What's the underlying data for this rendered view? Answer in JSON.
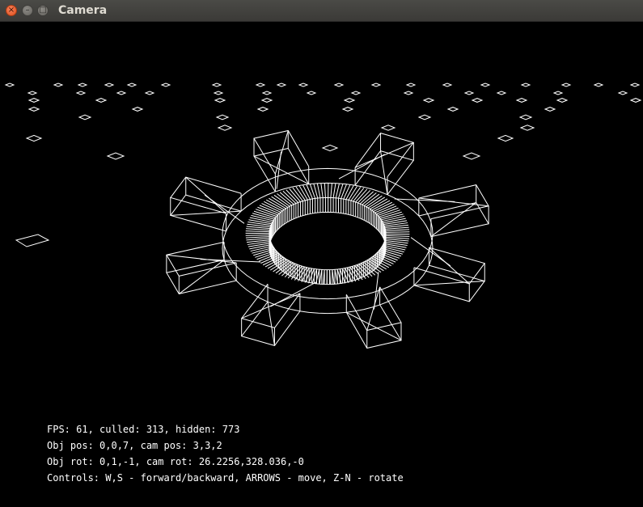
{
  "window": {
    "title": "Camera",
    "buttons": {
      "close": "×",
      "minimize": "–",
      "maximize": "□"
    }
  },
  "hud": {
    "line1": "FPS: 61, culled: 313, hidden: 773",
    "line2": "Obj pos: 0,0,7, cam pos: 3,3,2",
    "line3": "Obj rot: 0,1,-1, cam rot: 26.2256,328.036,-0",
    "line4": "Controls: W,S - forward/backward, ARROWS - move, Z-N - rotate"
  },
  "colors": {
    "background": "#000000",
    "wireframe": "#ffffff",
    "titlebar": "#3c3b37",
    "close_button": "#e95420"
  },
  "scene": {
    "object": "wireframe-gear",
    "gear_teeth": 8
  }
}
